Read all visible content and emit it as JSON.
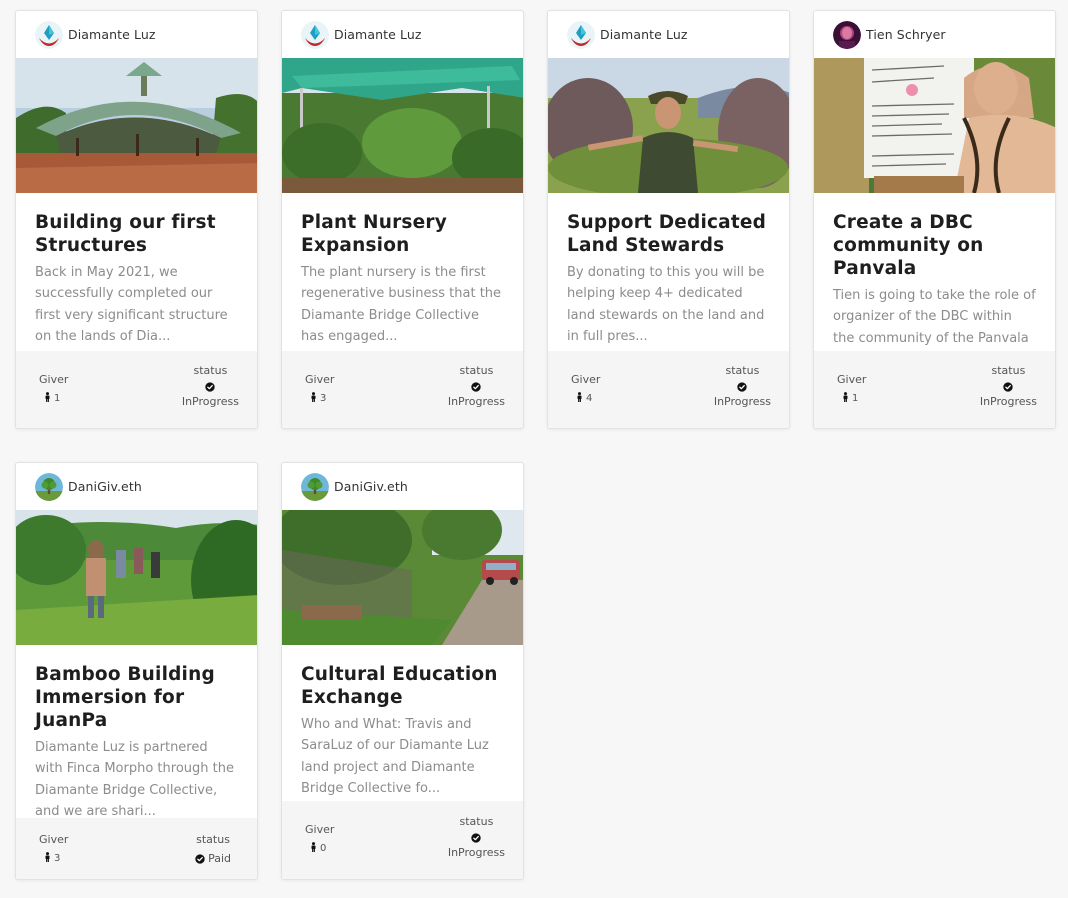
{
  "labels": {
    "giver": "Giver",
    "status": "status"
  },
  "cards": [
    {
      "author": "Diamante Luz",
      "avatar": "diamond-avatar",
      "image": "dome-structure-photo",
      "title": "Building our first Structures",
      "description": "Back in May 2021, we successfully completed our first very significant structure on the lands of Dia...",
      "givers": "1",
      "status": "InProgress"
    },
    {
      "author": "Diamante Luz",
      "avatar": "diamond-avatar",
      "image": "plant-nursery-photo",
      "title": "Plant Nursery Expansion",
      "description": "The plant nursery is the first regenerative business that the Diamante Bridge Collective has engaged...",
      "givers": "3",
      "status": "InProgress"
    },
    {
      "author": "Diamante Luz",
      "avatar": "diamond-avatar",
      "image": "land-steward-photo",
      "title": "Support Dedicated Land Stewards",
      "description": "By donating to this you will be helping keep 4+ dedicated land stewards on the land and in full pres...",
      "givers": "4",
      "status": "InProgress"
    },
    {
      "author": "Tien Schryer",
      "avatar": "person-avatar",
      "image": "whiteboard-presentation-photo",
      "title": "Create a DBC community on Panvala",
      "description": "Tien is going to take the role of organizer of the DBC within the community of the Panvala League....",
      "givers": "1",
      "status": "InProgress"
    },
    {
      "author": "DaniGiv.eth",
      "avatar": "tree-avatar",
      "image": "jungle-hike-photo",
      "title": "Bamboo Building Immersion for JuanPa",
      "description": "Diamante Luz is partnered with Finca Morpho through the Diamante Bridge Collective, and we are shari...",
      "givers": "3",
      "status": "Paid"
    },
    {
      "author": "DaniGiv.eth",
      "avatar": "tree-avatar",
      "image": "roadside-garden-photo",
      "title": "Cultural Education Exchange",
      "description": "Who and What: Travis and SaraLuz of our Diamante Luz land project and Diamante Bridge Collective fo...",
      "givers": "0",
      "status": "InProgress"
    }
  ]
}
